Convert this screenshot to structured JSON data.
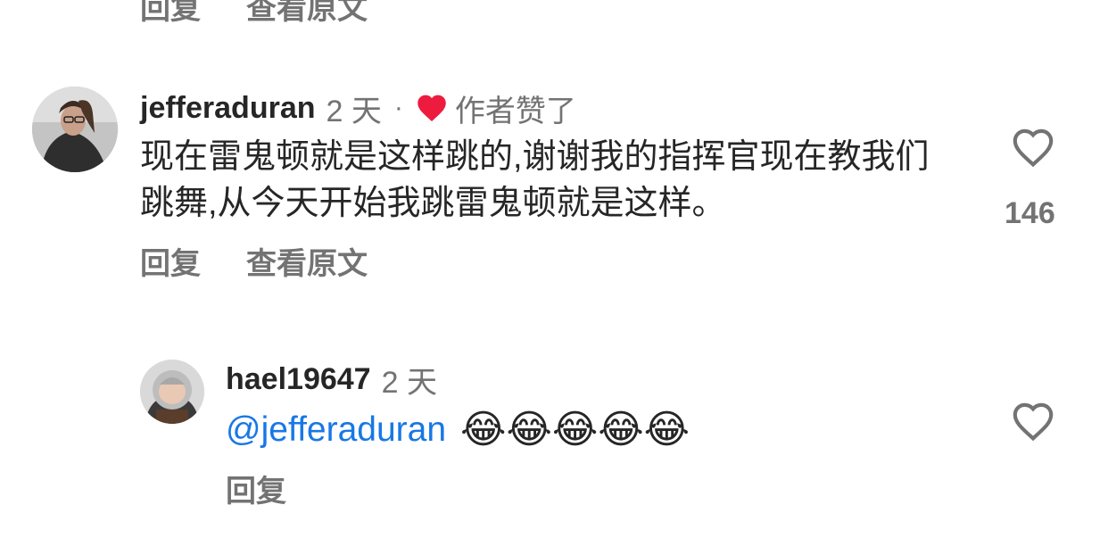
{
  "top_actions": {
    "reply": "回复",
    "view_original": "查看原文"
  },
  "comment1": {
    "username": "jefferaduran",
    "time": "2 天",
    "dot": "·",
    "liked_label": "作者赞了",
    "text": "现在雷鬼顿就是这样跳的,谢谢我的指挥官现在教我们跳舞,从今天开始我跳雷鬼顿就是这样。",
    "likes": "146",
    "reply": "回复",
    "view_original": "查看原文",
    "icon": "heart-outline-icon"
  },
  "comment2": {
    "username": "hael19647",
    "time": "2 天",
    "mention": "@jefferaduran",
    "emojis": "😂😂😂😂😂",
    "reply": "回复",
    "icon": "heart-outline-icon"
  },
  "colors": {
    "liked_heart": "#ed1c3f",
    "mention": "#1877e6",
    "secondary_text": "#737373"
  }
}
